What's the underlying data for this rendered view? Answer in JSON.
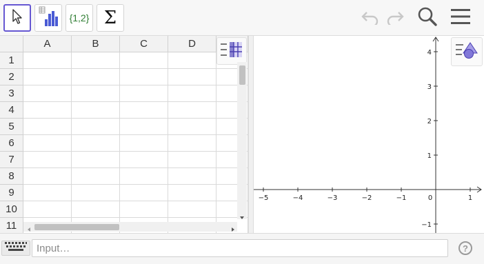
{
  "toolbar": {
    "tools": [
      {
        "name": "move-tool",
        "icon": "arrow-pointer-icon",
        "active": true
      },
      {
        "name": "one-variable-analysis-tool",
        "icon": "bar-chart-icon",
        "active": false
      },
      {
        "name": "create-list-tool",
        "label": "{1,2}",
        "active": false
      },
      {
        "name": "sum-tool",
        "label": "Σ",
        "active": false
      }
    ],
    "right_icons": [
      "undo-icon",
      "redo-icon",
      "search-icon",
      "menu-icon"
    ]
  },
  "spreadsheet": {
    "columns": [
      "A",
      "B",
      "C",
      "D"
    ],
    "rows": [
      "1",
      "2",
      "3",
      "4",
      "5",
      "6",
      "7",
      "8",
      "9",
      "10",
      "11"
    ]
  },
  "graphics": {
    "x_ticks": [
      "−5",
      "−4",
      "−3",
      "−2",
      "−1",
      "0",
      "1"
    ],
    "y_ticks": [
      "4",
      "3",
      "2",
      "1",
      "−1"
    ]
  },
  "input": {
    "placeholder": "Input…"
  },
  "help": {
    "label": "?"
  },
  "colors": {
    "accent": "#6557d2",
    "list_green": "#2e7d32",
    "icon_gray": "#666666"
  }
}
